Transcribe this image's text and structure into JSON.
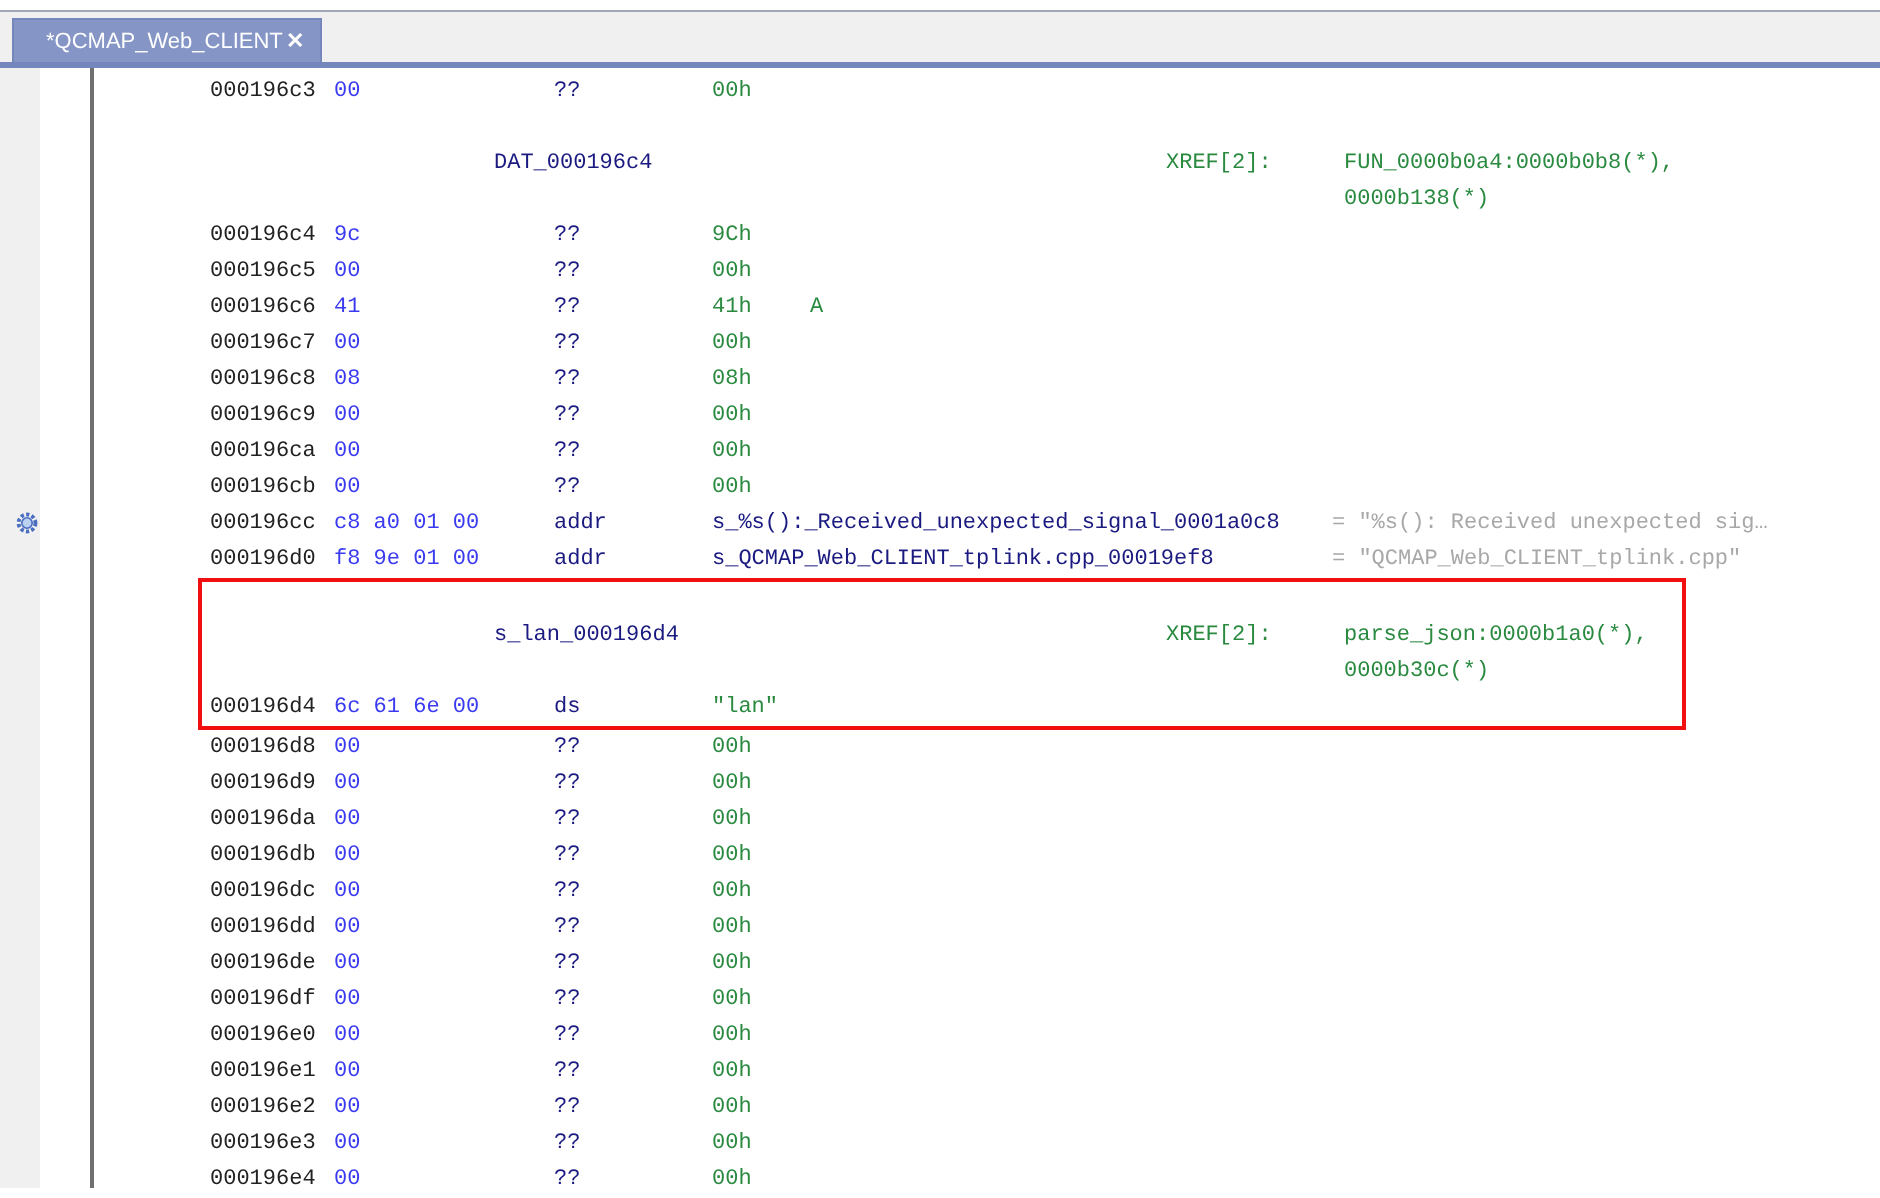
{
  "tab": {
    "title": "*QCMAP_Web_CLIENT",
    "close": "✕",
    "selected": true
  },
  "listing": [
    {
      "kind": "data",
      "address": "000196c3",
      "bytes": "00",
      "mnemonic": "??",
      "operand": {
        "kind": "value",
        "text": "00h"
      }
    },
    {
      "kind": "label",
      "name": "DAT_000196c4",
      "xref_label": "XREF[2]:",
      "refs": [
        "FUN_0000b0a4:0000b0b8(*),",
        "0000b138(*)"
      ]
    },
    {
      "kind": "data",
      "address": "000196c4",
      "bytes": "9c",
      "mnemonic": "??",
      "operand": {
        "kind": "value",
        "text": "9Ch"
      }
    },
    {
      "kind": "data",
      "address": "000196c5",
      "bytes": "00",
      "mnemonic": "??",
      "operand": {
        "kind": "value",
        "text": "00h"
      }
    },
    {
      "kind": "data",
      "address": "000196c6",
      "bytes": "41",
      "mnemonic": "??",
      "operand": {
        "kind": "value",
        "text": "41h"
      },
      "comment": {
        "kind": "char",
        "text": "A"
      }
    },
    {
      "kind": "data",
      "address": "000196c7",
      "bytes": "00",
      "mnemonic": "??",
      "operand": {
        "kind": "value",
        "text": "00h"
      }
    },
    {
      "kind": "data",
      "address": "000196c8",
      "bytes": "08",
      "mnemonic": "??",
      "operand": {
        "kind": "value",
        "text": "08h"
      }
    },
    {
      "kind": "data",
      "address": "000196c9",
      "bytes": "00",
      "mnemonic": "??",
      "operand": {
        "kind": "value",
        "text": "00h"
      }
    },
    {
      "kind": "data",
      "address": "000196ca",
      "bytes": "00",
      "mnemonic": "??",
      "operand": {
        "kind": "value",
        "text": "00h"
      }
    },
    {
      "kind": "data",
      "address": "000196cb",
      "bytes": "00",
      "mnemonic": "??",
      "operand": {
        "kind": "value",
        "text": "00h"
      }
    },
    {
      "kind": "data",
      "address": "000196cc",
      "bytes": "c8 a0 01 00",
      "mnemonic": "addr",
      "operand": {
        "kind": "reference",
        "text": "s_%s():_Received_unexpected_signal_0001a0c8"
      },
      "comment": {
        "kind": "string",
        "text": "= \"%s(): Received unexpected sig…"
      },
      "bookmarked": true
    },
    {
      "kind": "data",
      "address": "000196d0",
      "bytes": "f8 9e 01 00",
      "mnemonic": "addr",
      "operand": {
        "kind": "reference",
        "text": "s_QCMAP_Web_CLIENT_tplink.cpp_00019ef8"
      },
      "comment": {
        "kind": "string",
        "text": "= \"QCMAP_Web_CLIENT_tplink.cpp\""
      }
    },
    {
      "kind": "highlight",
      "rows": [
        {
          "kind": "label",
          "name": "s_lan_000196d4",
          "xref_label": "XREF[2]:",
          "refs": [
            "parse_json:0000b1a0(*),",
            "0000b30c(*)"
          ]
        },
        {
          "kind": "data",
          "address": "000196d4",
          "bytes": "6c 61 6e 00",
          "mnemonic": "ds",
          "operand": {
            "kind": "value",
            "text": "\"lan\""
          }
        }
      ]
    },
    {
      "kind": "data",
      "address": "000196d8",
      "bytes": "00",
      "mnemonic": "??",
      "operand": {
        "kind": "value",
        "text": "00h"
      }
    },
    {
      "kind": "data",
      "address": "000196d9",
      "bytes": "00",
      "mnemonic": "??",
      "operand": {
        "kind": "value",
        "text": "00h"
      }
    },
    {
      "kind": "data",
      "address": "000196da",
      "bytes": "00",
      "mnemonic": "??",
      "operand": {
        "kind": "value",
        "text": "00h"
      }
    },
    {
      "kind": "data",
      "address": "000196db",
      "bytes": "00",
      "mnemonic": "??",
      "operand": {
        "kind": "value",
        "text": "00h"
      }
    },
    {
      "kind": "data",
      "address": "000196dc",
      "bytes": "00",
      "mnemonic": "??",
      "operand": {
        "kind": "value",
        "text": "00h"
      }
    },
    {
      "kind": "data",
      "address": "000196dd",
      "bytes": "00",
      "mnemonic": "??",
      "operand": {
        "kind": "value",
        "text": "00h"
      }
    },
    {
      "kind": "data",
      "address": "000196de",
      "bytes": "00",
      "mnemonic": "??",
      "operand": {
        "kind": "value",
        "text": "00h"
      }
    },
    {
      "kind": "data",
      "address": "000196df",
      "bytes": "00",
      "mnemonic": "??",
      "operand": {
        "kind": "value",
        "text": "00h"
      }
    },
    {
      "kind": "data",
      "address": "000196e0",
      "bytes": "00",
      "mnemonic": "??",
      "operand": {
        "kind": "value",
        "text": "00h"
      }
    },
    {
      "kind": "data",
      "address": "000196e1",
      "bytes": "00",
      "mnemonic": "??",
      "operand": {
        "kind": "value",
        "text": "00h"
      }
    },
    {
      "kind": "data",
      "address": "000196e2",
      "bytes": "00",
      "mnemonic": "??",
      "operand": {
        "kind": "value",
        "text": "00h"
      }
    },
    {
      "kind": "data",
      "address": "000196e3",
      "bytes": "00",
      "mnemonic": "??",
      "operand": {
        "kind": "value",
        "text": "00h"
      }
    },
    {
      "kind": "data",
      "address": "000196e4",
      "bytes": "00",
      "mnemonic": "??",
      "operand": {
        "kind": "value",
        "text": "00h"
      }
    }
  ]
}
